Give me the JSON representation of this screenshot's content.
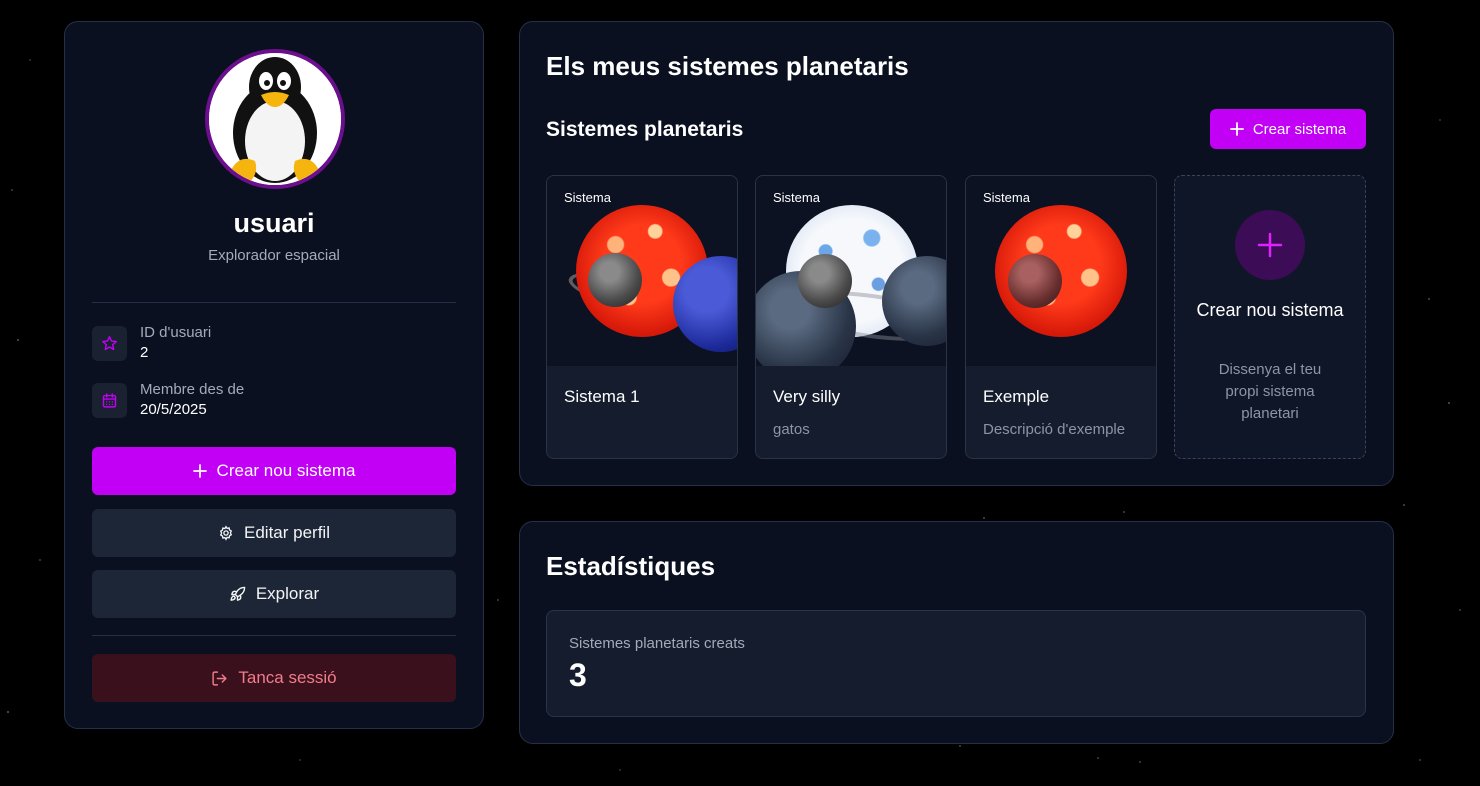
{
  "profile": {
    "username": "usuari",
    "role": "Explorador espacial",
    "avatar_icon": "tux-penguin-avatar",
    "id_label": "ID d'usuari",
    "id_value": "2",
    "member_label": "Membre des de",
    "member_value": "20/5/2025",
    "create_button": "Crear nou sistema",
    "edit_button": "Editar perfil",
    "explore_button": "Explorar",
    "logout_button": "Tanca sessió"
  },
  "systems_panel": {
    "title": "Els meus sistemes planetaris",
    "section_title": "Sistemes planetaris",
    "create_button": "Crear sistema",
    "systems": [
      {
        "tag": "Sistema",
        "name": "Sistema 1",
        "description": ""
      },
      {
        "tag": "Sistema",
        "name": "Very silly",
        "description": "gatos"
      },
      {
        "tag": "Sistema",
        "name": "Exemple",
        "description": "Descripció d'exemple"
      }
    ],
    "create_card": {
      "title": "Crear nou sistema",
      "description": "Dissenya el teu propi sistema planetari"
    }
  },
  "stats_panel": {
    "title": "Estadístiques",
    "created_label": "Sistemes planetaris creats",
    "created_value": "3"
  },
  "colors": {
    "accent": "#c100f5",
    "card_bg": "#0b1020",
    "danger_text": "#f17c8a"
  }
}
